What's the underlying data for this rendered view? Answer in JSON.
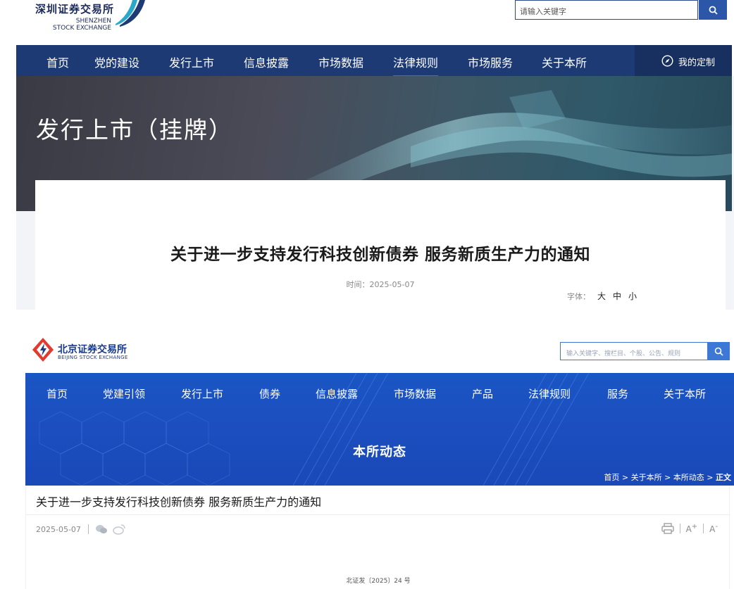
{
  "szse": {
    "logo": {
      "cn": "深圳证券交易所",
      "en_line1": "SHENZHEN",
      "en_line2": "STOCK EXCHANGE"
    },
    "search": {
      "placeholder": "请输入关键字",
      "button_icon": "search-icon"
    },
    "nav": {
      "items": [
        {
          "label": "首页"
        },
        {
          "label": "党的建设"
        },
        {
          "label": "发行上市"
        },
        {
          "label": "信息披露"
        },
        {
          "label": "市场数据"
        },
        {
          "label": "法律规则",
          "active": true
        },
        {
          "label": "市场服务"
        },
        {
          "label": "关于本所"
        }
      ],
      "custom_label": "我的定制",
      "custom_icon": "compass-icon"
    },
    "banner_title": "发行上市（挂牌）",
    "article": {
      "title": "关于进一步支持发行科技创新债券 服务新质生产力的通知",
      "time": "时间：2025-05-07",
      "font_label": "字体：",
      "font_large": "大",
      "font_medium": "中",
      "font_small": "小"
    },
    "colors": {
      "nav": "#1e3a74",
      "active_underline": "#e0353b",
      "search_button": "#2c56a8"
    }
  },
  "bse": {
    "logo": {
      "cn": "北京证券交易所",
      "en": "BEIJING STOCK EXCHANGE"
    },
    "search": {
      "placeholder": "输入关键字、搜栏目、个股、公告、规则",
      "button_icon": "search-icon"
    },
    "nav": {
      "items": [
        {
          "label": "首页"
        },
        {
          "label": "党建引领"
        },
        {
          "label": "发行上市"
        },
        {
          "label": "债券"
        },
        {
          "label": "信息披露"
        },
        {
          "label": "市场数据"
        },
        {
          "label": "产品"
        },
        {
          "label": "法律规则"
        },
        {
          "label": "服务"
        },
        {
          "label": "关于本所"
        }
      ]
    },
    "hero_title": "本所动态",
    "breadcrumb": {
      "path": "首页 > 关于本所 > 本所动态 > ",
      "current": "正文"
    },
    "article": {
      "title": "关于进一步支持发行科技创新债券 服务新质生产力的通知",
      "date": "2025-05-07",
      "share_icons": [
        "wechat-icon",
        "weibo-icon"
      ],
      "tools": {
        "print_icon": "printer-icon",
        "increase": "A",
        "increase_sup": "+",
        "decrease": "A",
        "decrease_sup": "-"
      },
      "doc_number": "北证发〔2025〕24 号"
    },
    "colors": {
      "hero": "#1a56c4",
      "search_button": "#3e78d6",
      "logo_red": "#e23b2e",
      "logo_blue": "#1a3a8c"
    }
  }
}
